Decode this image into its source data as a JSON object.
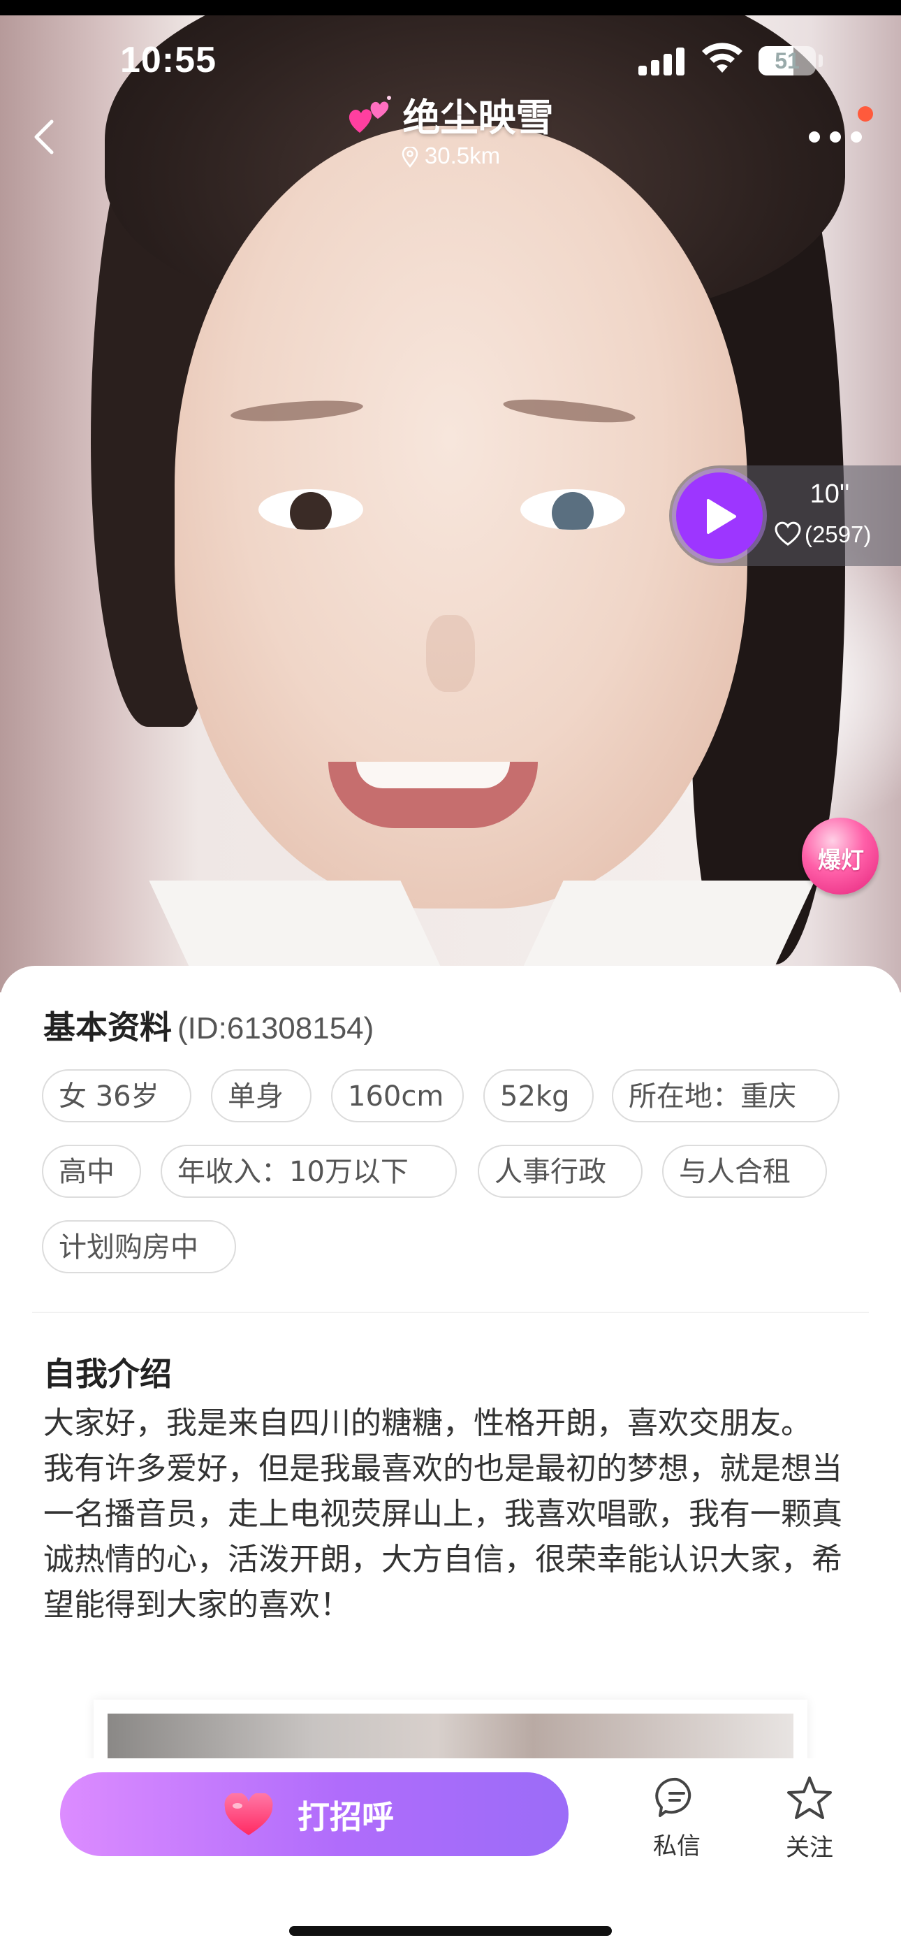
{
  "status_bar": {
    "time": "10:55",
    "battery_level": "51"
  },
  "profile_header": {
    "nickname": "绝尘映雪",
    "distance": "30.5km",
    "title_icon": "sparkling-hearts-icon"
  },
  "voice_intro": {
    "duration": "10''",
    "likes": "(2597)"
  },
  "boost_badge": {
    "label": "爆灯"
  },
  "basic_info": {
    "title": "基本资料",
    "id_label": "(ID:61308154)",
    "tags": [
      "女 36岁",
      "单身",
      "160cm",
      "52kg",
      "所在地：重庆",
      "高中",
      "年收入：10万以下",
      "人事行政",
      "与人合租",
      "计划购房中"
    ]
  },
  "self_intro": {
    "title": "自我介绍",
    "paragraph_1": "大家好，我是来自四川的糖糖，性格开朗，喜欢交朋友。",
    "paragraph_2": "我有许多爱好，但是我最喜欢的也是最初的梦想，就是想当一名播音员，走上电视荧屏山上，我喜欢唱歌，我有一颗真诚热情的心，活泼开朗，大方自信，很荣幸能认识大家，希望能得到大家的喜欢！"
  },
  "action_bar": {
    "greet_label": "打招呼",
    "message_label": "私信",
    "follow_label": "关注"
  },
  "colors": {
    "accent_purple": "#9d36ff",
    "greet_gradient_start": "#dc8cff",
    "greet_gradient_end": "#9b6cf8",
    "notify_dot": "#ff5a3c"
  }
}
